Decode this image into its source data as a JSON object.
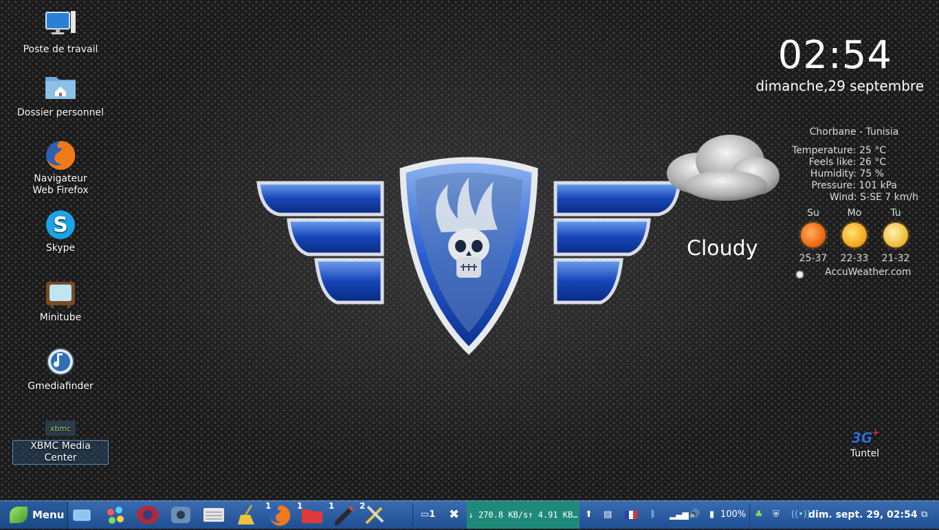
{
  "desktop_icons": [
    {
      "label": "Poste de travail",
      "icon": "computer-icon"
    },
    {
      "label": "Dossier personnel",
      "icon": "home-folder-icon"
    },
    {
      "label": "Navigateur Web Firefox",
      "icon": "firefox-icon"
    },
    {
      "label": "Skype",
      "icon": "skype-icon"
    },
    {
      "label": "Minitube",
      "icon": "tv-icon"
    },
    {
      "label": "Gmediafinder",
      "icon": "music-note-icon"
    },
    {
      "label": "XBMC Media Center",
      "icon": "xbmc-icon"
    },
    {
      "label": "Tuntel",
      "icon": "3g-plus-icon"
    }
  ],
  "widget_clock": {
    "time": "02:54",
    "date": "dimanche,29 septembre"
  },
  "weather": {
    "location": "Chorbane - Tunisia",
    "temperature": "Temperature: 25 °C",
    "feels_like": "Feels like: 26 °C",
    "humidity": "Humidity: 75 %",
    "pressure": "Pressure: 101 kPa",
    "wind": "Wind: S-SE 7 km/h",
    "condition": "Cloudy",
    "forecast": [
      {
        "day": "Su",
        "range": "25-37"
      },
      {
        "day": "Mo",
        "range": "22-33"
      },
      {
        "day": "Tu",
        "range": "21-32"
      }
    ],
    "source": "AccuWeather.com"
  },
  "taskbar": {
    "menu_label": "Menu",
    "badges": {
      "firefox": "1",
      "files": "1",
      "editor": "1",
      "tools": "2",
      "chat": "1"
    },
    "network": "↓ 270.8 KB/s↑ 4.91 KB…",
    "battery": "100%",
    "clock": "dim. sept. 29, 02:54"
  },
  "colors": {
    "taskbar": "#2a5c9c",
    "net_bg": "#1f8a7a",
    "accent": "#3b6cb0"
  }
}
